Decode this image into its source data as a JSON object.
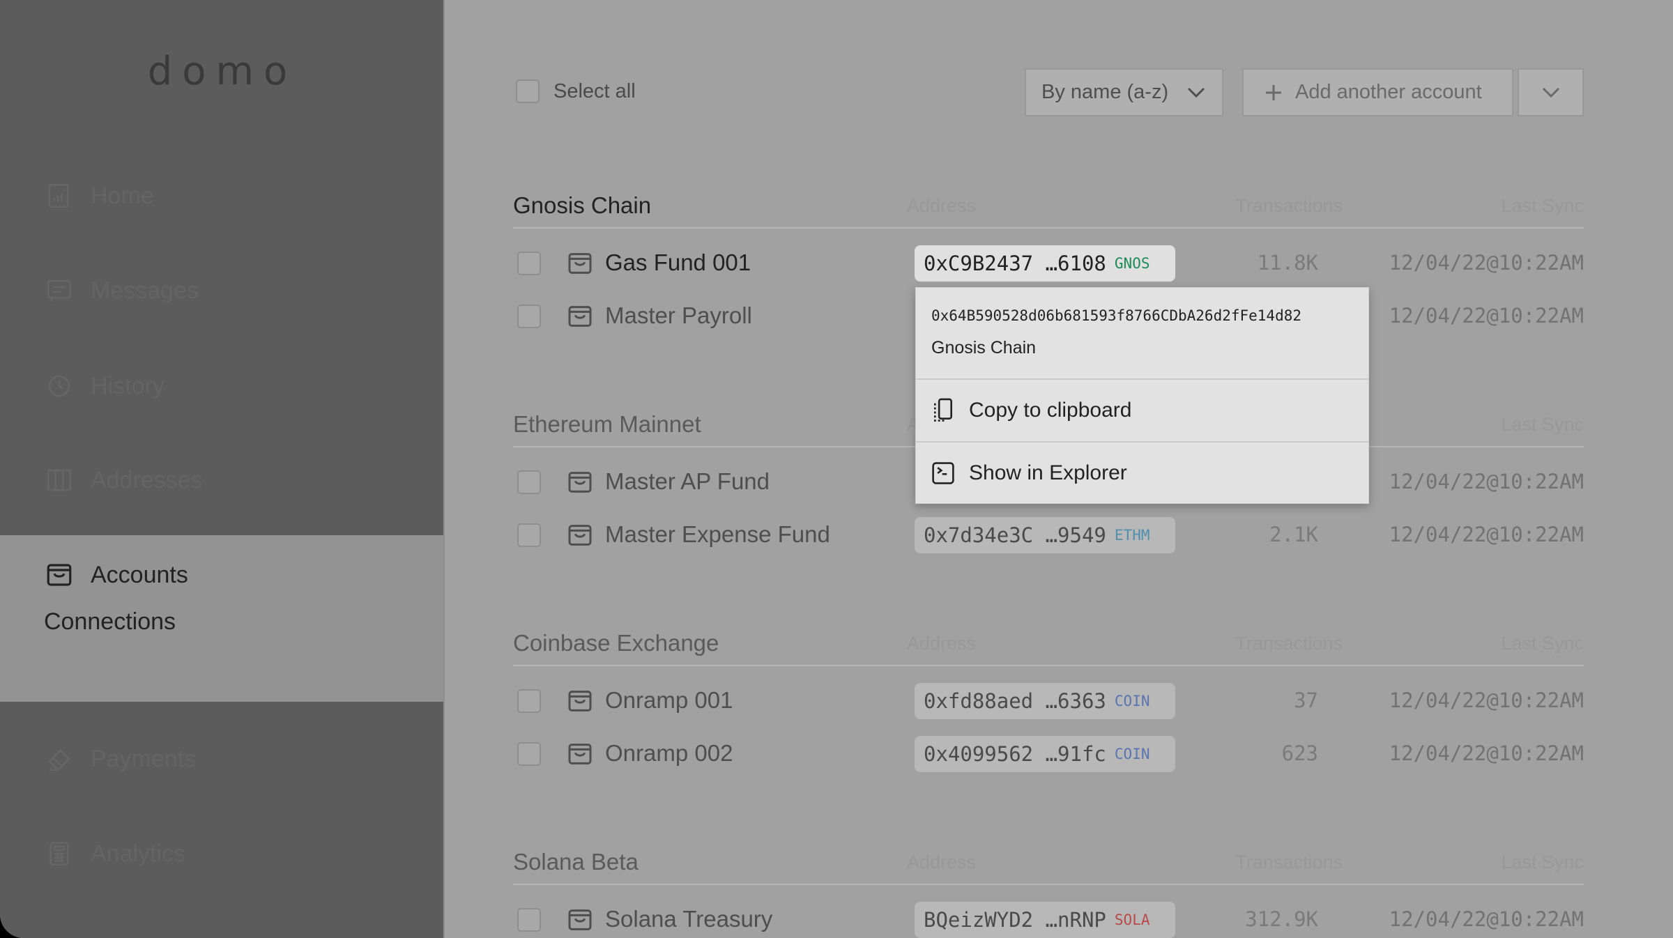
{
  "app": {
    "logo": "domo"
  },
  "sidebar": {
    "items": [
      {
        "label": "Home",
        "icon": "dashboard-icon"
      },
      {
        "label": "Messages",
        "icon": "message-icon"
      },
      {
        "label": "History",
        "icon": "history-icon"
      },
      {
        "label": "Addresses",
        "icon": "address-book-icon"
      }
    ],
    "active": {
      "label": "Accounts",
      "icon": "wallet-icon",
      "sub_items": [
        "Connections"
      ]
    },
    "bottom_items": [
      {
        "label": "Payments",
        "icon": "card-icon"
      },
      {
        "label": "Analytics",
        "icon": "calculator-icon"
      }
    ]
  },
  "toolbar": {
    "select_all": "Select all",
    "sort_label": "By name (a-z)",
    "add_label": "Add another account"
  },
  "columns": {
    "address": "Address",
    "transactions": "Transactions",
    "last_sync": "Last Sync"
  },
  "sections": [
    {
      "title": "Gnosis Chain",
      "rows": [
        {
          "name": "Gas Fund 001",
          "address": "0xC9B2437 …6108",
          "tag": "GNOS",
          "transactions": "11.8K",
          "last_sync": "12/04/22@10:22AM",
          "active": true
        },
        {
          "name": "Master Payroll",
          "address": "",
          "tag": "",
          "transactions": "",
          "last_sync": "12/04/22@10:22AM"
        }
      ]
    },
    {
      "title": "Ethereum Mainnet",
      "rows": [
        {
          "name": "Master AP Fund",
          "address": "",
          "tag": "",
          "transactions": "",
          "last_sync": "12/04/22@10:22AM"
        },
        {
          "name": "Master Expense Fund",
          "address": "0x7d34e3C …9549",
          "tag": "ETHM",
          "transactions": "2.1K",
          "last_sync": "12/04/22@10:22AM"
        }
      ]
    },
    {
      "title": "Coinbase Exchange",
      "rows": [
        {
          "name": "Onramp 001",
          "address": "0xfd88aed …6363",
          "tag": "COIN",
          "transactions": "37",
          "last_sync": "12/04/22@10:22AM"
        },
        {
          "name": "Onramp 002",
          "address": "0x4099562 …91fc",
          "tag": "COIN",
          "transactions": "623",
          "last_sync": "12/04/22@10:22AM"
        }
      ]
    },
    {
      "title": "Solana Beta",
      "rows": [
        {
          "name": "Solana Treasury",
          "address": "BQeizWYD2 …nRNP",
          "tag": "SOLA",
          "transactions": "312.9K",
          "last_sync": "12/04/22@10:22AM"
        }
      ]
    }
  ],
  "tag_colors": {
    "GNOS": "#1f8a5a",
    "ETHM": "#4f8fae",
    "COIN": "#5a74b0",
    "SOLA": "#b84a4a"
  },
  "context_menu": {
    "full_address": "0x64B590528d06b681593f8766CDbA26d2fFe14d82",
    "chain": "Gnosis Chain",
    "items": [
      {
        "label": "Copy to clipboard",
        "icon": "clipboard-icon"
      },
      {
        "label": "Show in Explorer",
        "icon": "terminal-icon"
      }
    ]
  }
}
